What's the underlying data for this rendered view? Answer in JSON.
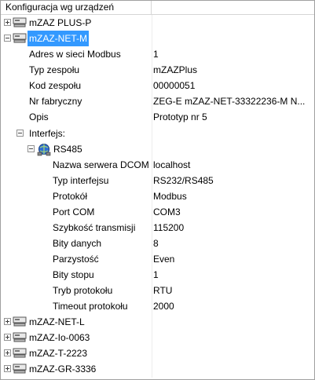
{
  "header": {
    "col1": "Konfiguracja wg urządzeń",
    "col2": ""
  },
  "devices": {
    "d0": "mZAZ PLUS-P",
    "d1": "mZAZ-NET-M",
    "d2": "mZAZ-NET-L",
    "d3": "mZAZ-Io-0063",
    "d4": "mZAZ-T-2223",
    "d5": "mZAZ-GR-3336"
  },
  "props": [
    {
      "label": "Adres w sieci Modbus",
      "value": "1"
    },
    {
      "label": "Typ zespołu",
      "value": "mZAZPlus"
    },
    {
      "label": "Kod zespołu",
      "value": "00000051"
    },
    {
      "label": "Nr fabryczny",
      "value": "ZEG-E  mZAZ-NET-33322236-M N..."
    },
    {
      "label": "Opis",
      "value": "Prototyp nr 5"
    }
  ],
  "interfaces_label": "Interfejs:",
  "rs485_label": "RS485",
  "rs485": [
    {
      "label": "Nazwa serwera DCOM",
      "value": "localhost"
    },
    {
      "label": "Typ interfejsu",
      "value": "RS232/RS485"
    },
    {
      "label": "Protokół",
      "value": "Modbus"
    },
    {
      "label": "Port COM",
      "value": "COM3"
    },
    {
      "label": "Szybkość transmisji",
      "value": "115200"
    },
    {
      "label": "Bity danych",
      "value": "8"
    },
    {
      "label": "Parzystość",
      "value": "Even"
    },
    {
      "label": "Bity stopu",
      "value": "1"
    },
    {
      "label": "Tryb protokołu",
      "value": "RTU"
    },
    {
      "label": "Timeout protokołu",
      "value": "2000"
    }
  ],
  "colors": {
    "selection": "#3399ff"
  },
  "icons": {
    "device": "device-icon",
    "network": "network-icon",
    "expand": "expand-icon",
    "collapse": "collapse-icon"
  }
}
